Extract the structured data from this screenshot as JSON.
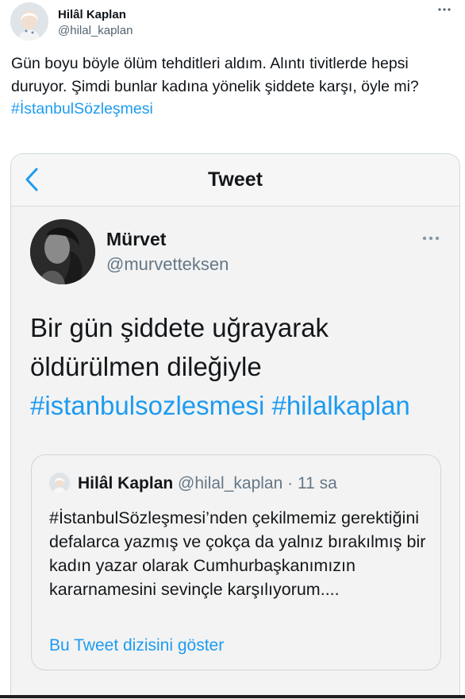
{
  "author": {
    "name": "Hilâl Kaplan",
    "handle": "@hilal_kaplan"
  },
  "tweet": {
    "text": "Gün boyu böyle ölüm tehditleri aldım. Alıntı tivitlerde hepsi duruyor. Şimdi bunlar kadına yönelik şiddete karşı, öyle mi?",
    "hashtag": "#İstanbulSözleşmesi"
  },
  "screenshot": {
    "header_title": "Tweet",
    "user": {
      "name": "Mürvet",
      "handle": "@murvetteksen"
    },
    "text": "Bir gün şiddete uğrayarak öldürülmen dileğiyle",
    "hashtags": "#istanbulsozlesmesi #hilalkaplan",
    "quote": {
      "name": "Hilâl Kaplan",
      "handle": "@hilal_kaplan",
      "time": "· 11 sa",
      "text": "#İstanbulSözleşmesi’nden çekilmemiz gerektiğini defalarca yazmış ve çokça da yalnız bırakılmış bir kadın yazar olarak Cumhurbaşkanımızın kararnamesini sevinçle karşılıyorum....",
      "link": "Bu Tweet dizisini göster"
    }
  },
  "icons": {
    "more": "more-horizontal-icon",
    "back": "chevron-left-icon"
  },
  "colors": {
    "link_blue": "#1d9bf0",
    "text_primary": "#0f1419",
    "text_secondary": "#536471"
  }
}
